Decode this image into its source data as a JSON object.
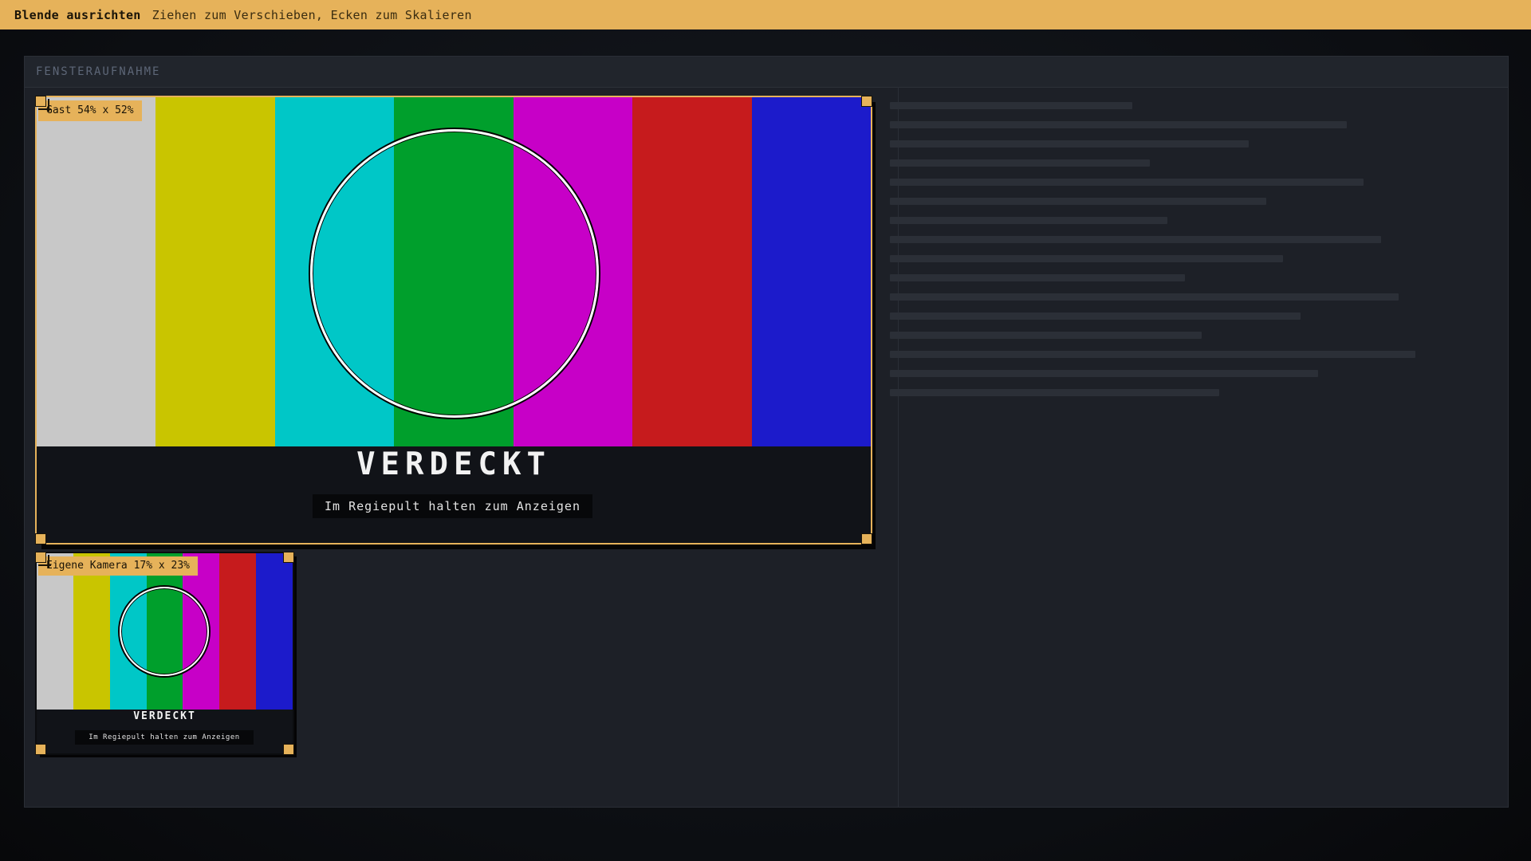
{
  "topbar": {
    "title": "Blende ausrichten",
    "hint": "Ziehen zum Verschieben, Ecken zum Skalieren"
  },
  "panel": {
    "title": "FENSTERAUFNAHME"
  },
  "colors": {
    "accent": "#e6b25a",
    "panel_bg": "#1d2027",
    "cover_bg": "#111318",
    "test_bars": [
      "#c8c8c8",
      "#c9c500",
      "#00c7c7",
      "#009f2c",
      "#c700c7",
      "#c61b1d",
      "#1c1bcb"
    ]
  },
  "guest_frame": {
    "label": "Gast 54% x 52%",
    "width_percent": 54,
    "height_percent": 52,
    "covered_title": "VERDECKT",
    "covered_hint": "Im Regiepult halten zum Anzeigen"
  },
  "self_frame": {
    "label": "Eigene Kamera 17% x 23%",
    "width_percent": 17,
    "height_percent": 23,
    "covered_title": "VERDECKT",
    "covered_hint": "Im Regiepult halten zum Anzeigen"
  },
  "icons": {
    "handle": "resize-handle-icon",
    "move": "move-crosshair-icon"
  }
}
